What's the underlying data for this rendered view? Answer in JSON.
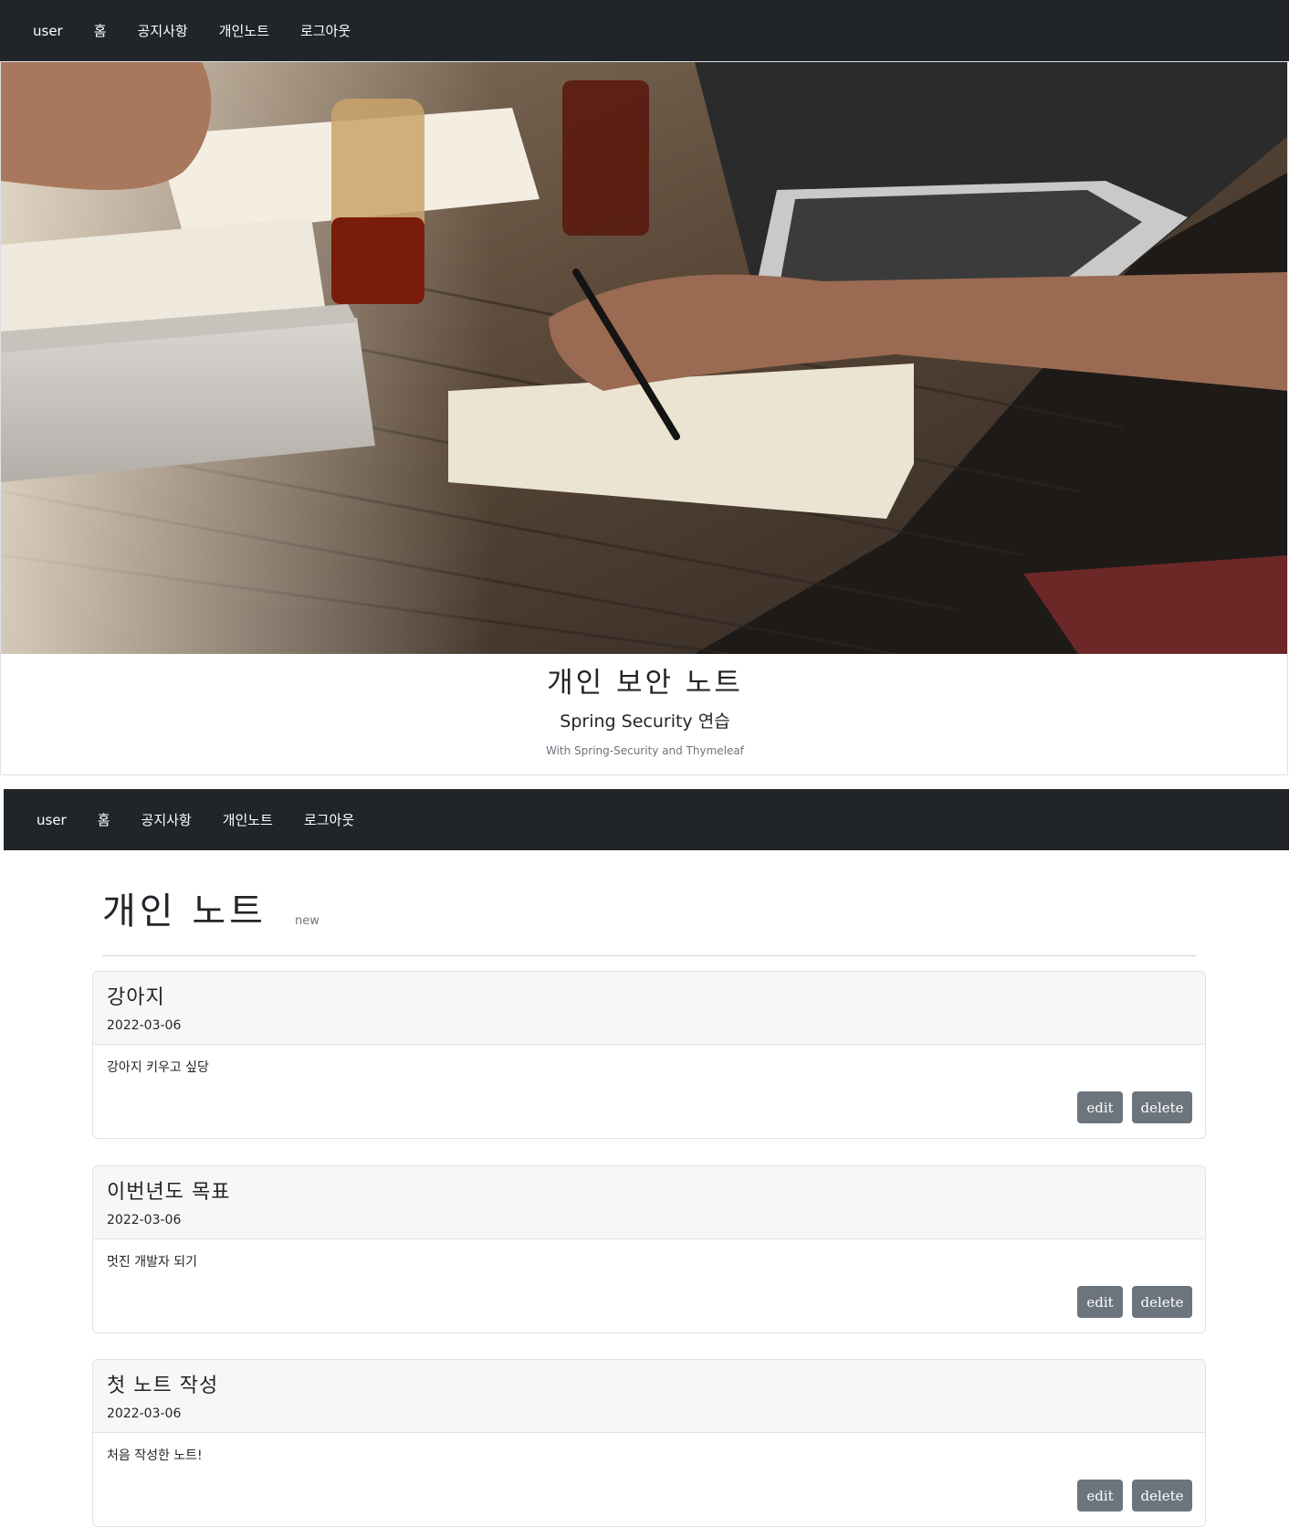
{
  "nav": {
    "items": [
      "user",
      "홈",
      "공지사항",
      "개인노트",
      "로그아웃"
    ]
  },
  "hero": {
    "image": "photo of people working at a wooden table with laptops, notebook and pen",
    "title": "개인 보안 노트",
    "subtitle": "Spring Security 연습",
    "note": "With Spring-Security and Thymeleaf"
  },
  "notes_page": {
    "title": "개인 노트",
    "new_label": "new",
    "edit_label": "edit",
    "delete_label": "delete",
    "notes": [
      {
        "title": "강아지",
        "date": "2022-03-06",
        "content": "강아지 키우고 싶당"
      },
      {
        "title": "이번년도 목표",
        "date": "2022-03-06",
        "content": "멋진 개발자 되기"
      },
      {
        "title": "첫 노트 작성",
        "date": "2022-03-06",
        "content": "처음 작성한 노트!"
      }
    ]
  },
  "colors": {
    "navbar": "#212529",
    "button": "#6c757d",
    "card_header": "#f7f7f7"
  }
}
